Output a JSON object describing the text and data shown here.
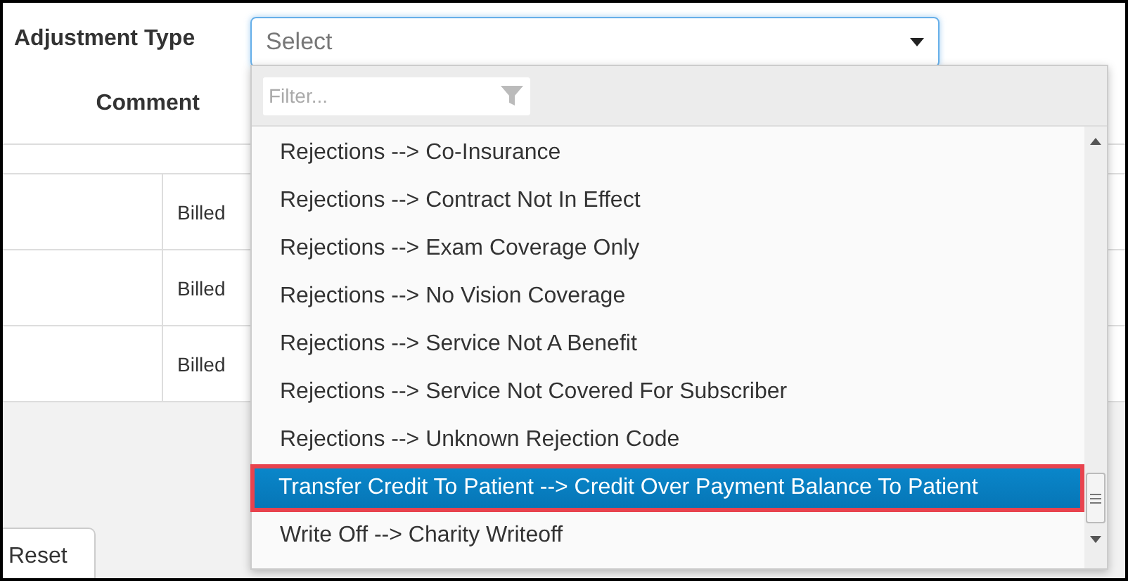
{
  "adjustment_type": {
    "label": "Adjustment Type",
    "placeholder": "Select"
  },
  "comment": {
    "label": "Comment"
  },
  "table": {
    "rows": [
      {
        "column_2": "Billed"
      },
      {
        "column_2": "Billed"
      },
      {
        "column_2": "Billed"
      }
    ]
  },
  "reset_button": {
    "label": "Reset"
  },
  "dropdown": {
    "filter_placeholder": "Filter...",
    "options": [
      {
        "label": "Rejections --> Co-Insurance",
        "selected": false
      },
      {
        "label": "Rejections --> Contract Not In Effect",
        "selected": false
      },
      {
        "label": "Rejections --> Exam Coverage Only",
        "selected": false
      },
      {
        "label": "Rejections --> No Vision Coverage",
        "selected": false
      },
      {
        "label": "Rejections --> Service Not A Benefit",
        "selected": false
      },
      {
        "label": "Rejections --> Service Not Covered For Subscriber",
        "selected": false
      },
      {
        "label": "Rejections --> Unknown Rejection Code",
        "selected": false
      },
      {
        "label": "Transfer Credit To Patient --> Credit Over Payment Balance To Patient",
        "selected": true
      },
      {
        "label": "Write Off --> Charity Writeoff",
        "selected": false
      }
    ]
  }
}
